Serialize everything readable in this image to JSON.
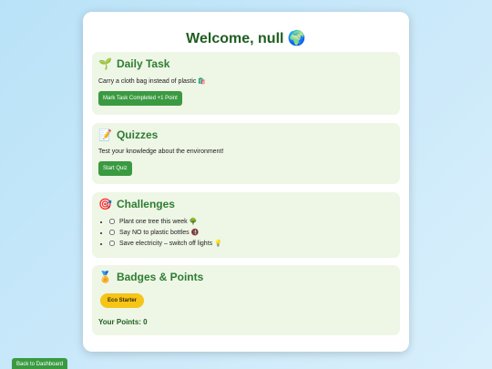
{
  "header": {
    "title": "Welcome, null 🌍"
  },
  "daily_task": {
    "icon": "🌱",
    "heading": "Daily Task",
    "text": "Carry a cloth bag instead of plastic 🛍️",
    "button_label": "Mark Task Completed +1 Point"
  },
  "quizzes": {
    "icon": "📝",
    "heading": "Quizzes",
    "text": "Test your knowledge about the environment!",
    "button_label": "Start Quiz"
  },
  "challenges": {
    "icon": "🎯",
    "heading": "Challenges",
    "items": [
      {
        "label": "Plant one tree this week 🌳",
        "checked": false
      },
      {
        "label": "Say NO to plastic bottles 🚯",
        "checked": false
      },
      {
        "label": "Save electricity – switch off lights 💡",
        "checked": false
      }
    ]
  },
  "badges": {
    "icon": "🏅",
    "heading": "Badges & Points",
    "badge_label": "Eco Starter",
    "points_label": "Your Points: 0"
  },
  "footer": {
    "back_label": "Back to Dashboard"
  },
  "colors": {
    "accent_green": "#3a9a41",
    "heading_green": "#2e7d32",
    "section_bg": "#eef6e6",
    "badge_yellow": "#f5c518"
  }
}
